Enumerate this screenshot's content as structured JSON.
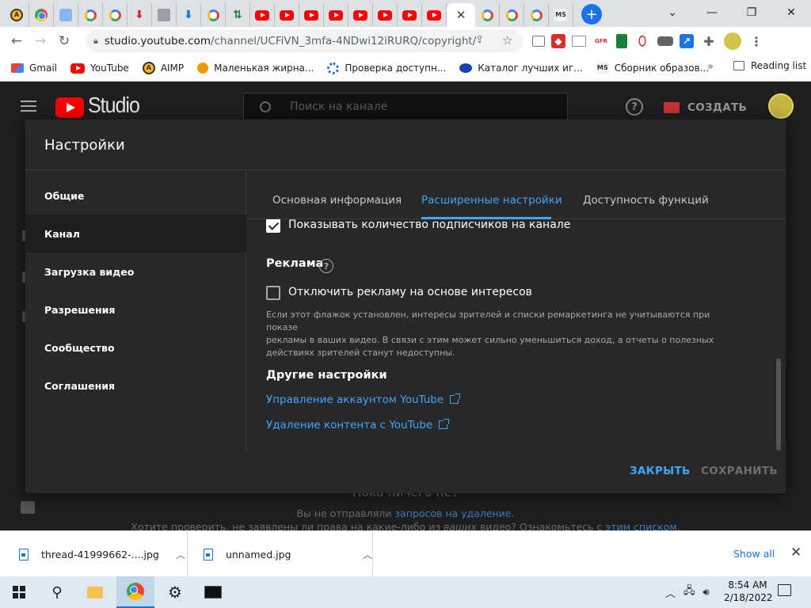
{
  "browser": {
    "tabs": [
      {
        "icon": "aimp-icon"
      },
      {
        "icon": "chrome-icon"
      },
      {
        "icon": "gear-icon"
      },
      {
        "icon": "google-icon"
      },
      {
        "icon": "google-icon"
      },
      {
        "icon": "download-red-icon"
      },
      {
        "icon": "image-icon"
      },
      {
        "icon": "download-blue-icon"
      },
      {
        "icon": "google-icon"
      },
      {
        "icon": "green-arrows-icon"
      },
      {
        "icon": "youtube-icon"
      },
      {
        "icon": "youtube-icon"
      },
      {
        "icon": "youtube-icon"
      },
      {
        "icon": "youtube-icon"
      },
      {
        "icon": "youtube-icon"
      },
      {
        "icon": "youtube-icon"
      },
      {
        "icon": "youtube-icon"
      },
      {
        "icon": "youtube-icon",
        "active": false
      },
      {
        "icon": "close-icon",
        "active": true
      },
      {
        "icon": "google-icon"
      },
      {
        "icon": "google-icon"
      },
      {
        "icon": "google-icon"
      },
      {
        "icon": "ms-icon"
      }
    ],
    "new_tab": "+",
    "url_host": "studio.youtube.com",
    "url_path": "/channel/UCFiVN_3mfa-4NDwi12iRURQ/copyright/...",
    "bookmarks": [
      {
        "label": "Gmail",
        "icon": "gmail-icon"
      },
      {
        "label": "YouTube",
        "icon": "youtube-icon"
      },
      {
        "label": "AIMP",
        "icon": "aimp-icon"
      },
      {
        "label": "Маленькая жирна...",
        "icon": "cat-icon"
      },
      {
        "label": "Проверка доступн...",
        "icon": "gear-icon"
      },
      {
        "label": "Каталог лучших иг...",
        "icon": "flag-icon"
      },
      {
        "label": "Сборник образов...",
        "icon": "ms-icon"
      }
    ],
    "bookmarks_more": "»",
    "reading_list": "Reading list"
  },
  "studio": {
    "logo_text": "Studio",
    "search_placeholder": "Поиск на канале",
    "help": "?",
    "create_label": "СОЗДАТЬ",
    "bg_title": "Пока ничего нет",
    "bg_line1_pre": "Вы не отправляли ",
    "bg_line1_link": "запросов на удаление",
    "bg_line1_post": ".",
    "bg_line2_pre": "Хотите проверить, не заявлены ли права на какие-либо из ",
    "bg_line2_em": "ваших",
    "bg_line2_mid": " видео? Ознакомьтесь с ",
    "bg_line2_link": "этим списком",
    "bg_line2_post": "."
  },
  "modal": {
    "title": "Настройки",
    "nav": [
      "Общие",
      "Канал",
      "Загрузка видео",
      "Разрешения",
      "Сообщество",
      "Соглашения"
    ],
    "active_nav": 1,
    "tabs": [
      "Основная информация",
      "Расширенные настройки",
      "Доступность функций"
    ],
    "active_tab": 1,
    "show_subs_label": "Показывать количество подписчиков на канале",
    "show_subs_checked": true,
    "ads_heading": "Реклама",
    "ads_help": "?",
    "ads_checkbox_label": "Отключить рекламу на основе интересов",
    "ads_checkbox_checked": false,
    "ads_desc_1": "Если этот флажок установлен, интересы зрителей и списки ремаркетинга не учитываются при показе",
    "ads_desc_2": "рекламы в ваших видео. В связи с этим может сильно уменьшиться доход, а отчеты о полезных",
    "ads_desc_3": "действиях зрителей станут недоступны.",
    "other_heading": "Другие настройки",
    "link_manage": "Управление аккаунтом YouTube",
    "link_delete": "Удаление контента с YouTube",
    "btn_close": "ЗАКРЫТЬ",
    "btn_save": "СОХРАНИТЬ"
  },
  "downloads": {
    "items": [
      {
        "name": "thread-41999662-....jpg"
      },
      {
        "name": "unnamed.jpg"
      }
    ],
    "show_all": "Show all",
    "close": "✕"
  },
  "taskbar": {
    "time": "8:54 AM",
    "date": "2/18/2022"
  }
}
